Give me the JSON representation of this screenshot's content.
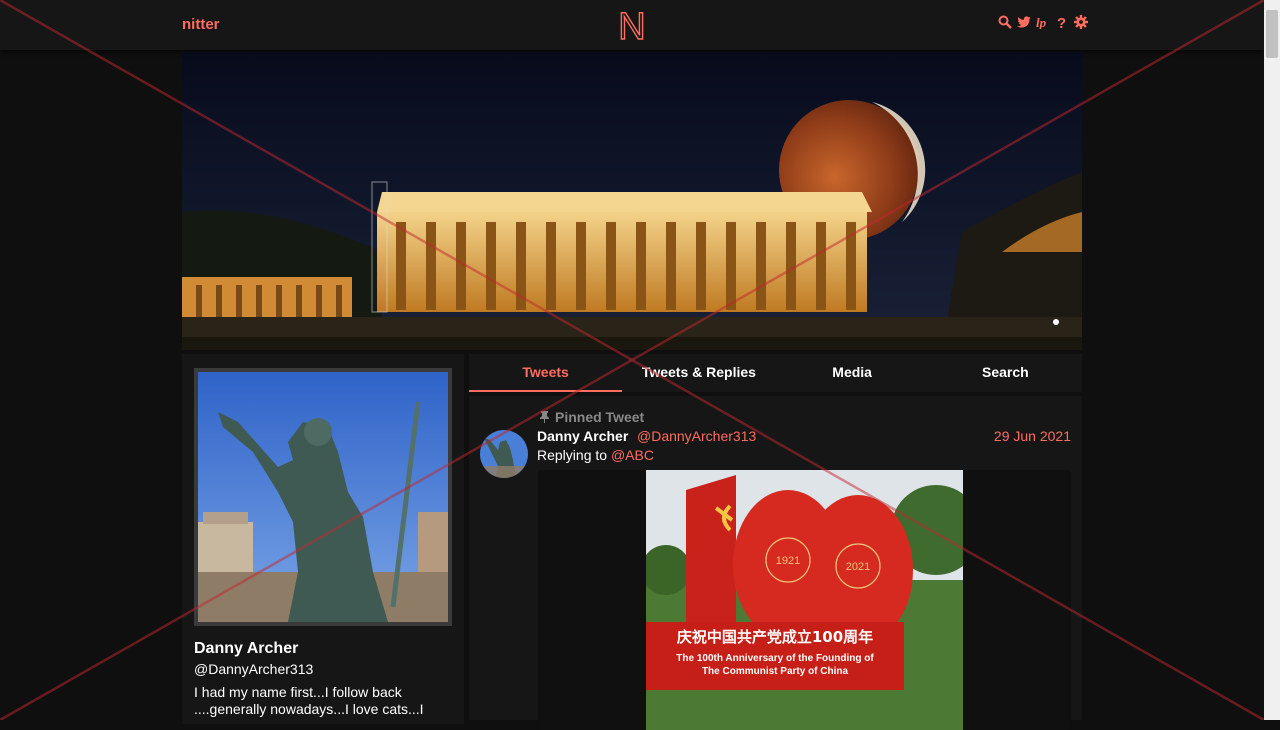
{
  "navbar": {
    "brand": "nitter",
    "logo_letter": "N",
    "icons": [
      "search-icon",
      "twitter-icon",
      "lp-icon",
      "help-icon",
      "settings-icon"
    ]
  },
  "profile": {
    "name": "Danny Archer",
    "handle": "@DannyArcher313",
    "bio": "I had my name first...I follow back ....generally nowadays...I love cats...I"
  },
  "tabs": [
    {
      "label": "Tweets",
      "active": true
    },
    {
      "label": "Tweets & Replies",
      "active": false
    },
    {
      "label": "Media",
      "active": false
    },
    {
      "label": "Search",
      "active": false
    }
  ],
  "tweet": {
    "pinned_label": "Pinned Tweet",
    "name": "Danny Archer",
    "handle": "@DannyArcher313",
    "date": "29 Jun 2021",
    "replying_to_label": "Replying to",
    "replying_to_handle": "@ABC",
    "image_text": {
      "year_start": "1921",
      "year_end": "2021",
      "chinese": "庆祝中国共产党成立100周年",
      "english_line1": "The 100th Anniversary of the Founding of",
      "english_line2": "The Communist Party of China"
    }
  },
  "colors": {
    "accent": "#ff6c60",
    "background": "#0f0f0f",
    "panel": "#161616",
    "navbar": "#161616",
    "muted": "#888888"
  }
}
